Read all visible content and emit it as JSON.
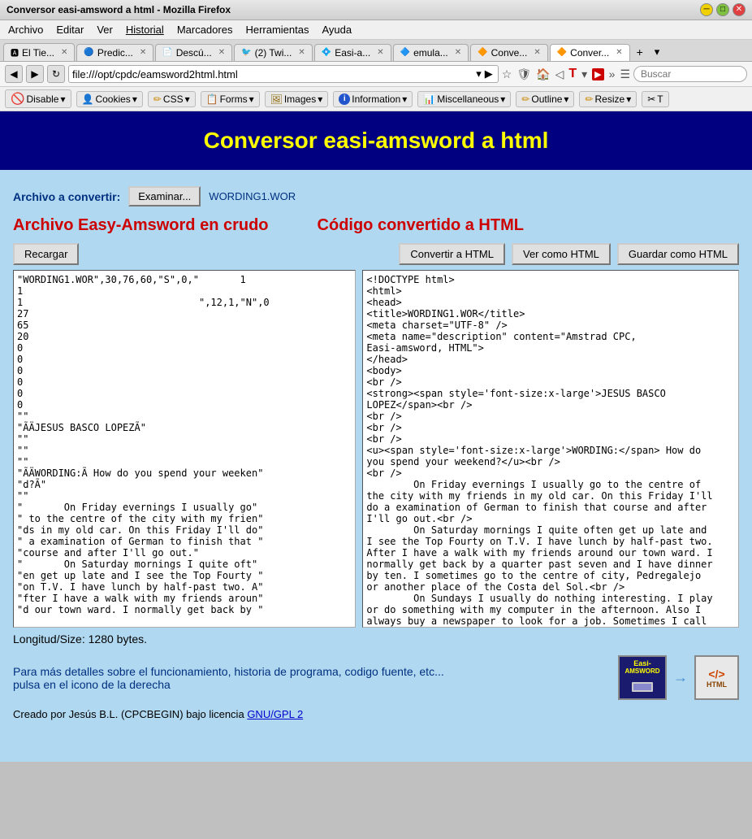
{
  "window": {
    "title": "Conversor easi-amsword a html - Mozilla Firefox"
  },
  "menu": {
    "items": [
      "Archivo",
      "Editar",
      "Ver",
      "Historial",
      "Marcadores",
      "Herramientas",
      "Ayuda"
    ]
  },
  "tabs": [
    {
      "label": "El Tie...",
      "icon": "🅰",
      "active": false
    },
    {
      "label": "Predic...",
      "icon": "🔵",
      "active": false
    },
    {
      "label": "Descú...",
      "icon": "📄",
      "active": false
    },
    {
      "label": "(2) Twi...",
      "icon": "🐦",
      "active": false
    },
    {
      "label": "Easi-a...",
      "icon": "💠",
      "active": false
    },
    {
      "label": "emula...",
      "icon": "🔷",
      "active": false
    },
    {
      "label": "Conve...",
      "icon": "🔶",
      "active": false
    },
    {
      "label": "Conver...",
      "icon": "🔶",
      "active": true
    }
  ],
  "address": {
    "url": "file:///opt/cpdc/eamsword2html.html",
    "search_placeholder": "Buscar"
  },
  "toolbar": {
    "disable_label": "Disable",
    "cookies_label": "Cookies",
    "css_label": "CSS",
    "forms_label": "Forms",
    "images_label": "Images",
    "information_label": "Information",
    "miscellaneous_label": "Miscellaneous",
    "outline_label": "Outline",
    "resize_label": "Resize"
  },
  "page": {
    "title": "Conversor easi-amsword a html",
    "file_label": "Archivo a convertir:",
    "browse_label": "Examinar...",
    "file_name": "WORDING1.WOR",
    "raw_title": "Archivo Easy-Amsword en crudo",
    "html_title": "Código convertido a HTML",
    "reload_btn": "Recargar",
    "convert_btn": "Convertir a HTML",
    "view_btn": "Ver como HTML",
    "save_btn": "Guardar como HTML",
    "raw_content": "\"WORDING1.WOR\",30,76,60,\"S\",0,\"       1\n1\n1                              \",12,1,\"N\",0\n27\n65\n20\n0\n0\n0\n0\n0\n0\n\"\"\n\"ÃÄJESUS BASCO LOPEZÃ\"\n\"\"\n\"\"\n\"\"\n\"ÃÄWORDING:Ã How do you spend your weeken\"\n\"d?Ã\"\n\"\"\n\"       On Friday evernings I usually go\"\n\" to the centre of the city with my frien\"\n\"ds in my old car. On this Friday I'll do\"\n\" a examination of German to finish that \"\n\"course and after I'll go out.\"\n\"       On Saturday mornings I quite oft\"\n\"en get up late and I see the Top Fourty \"\n\"on T.V. I have lunch by half-past two. A\"\n\"fter I have a walk with my friends aroun\"\n\"d our town ward. I normally get back by \"",
    "html_content": "<!DOCTYPE html>\n<html>\n<head>\n<title>WORDING1.WOR</title>\n<meta charset=\"UTF-8\" />\n<meta name=\"description\" content=\"Amstrad CPC,\nEasi-amsword, HTML\">\n</head>\n<body>\n<br />\n<strong><span style='font-size:x-large'>JESUS BASCO\nLOPEZ</span><br />\n<br />\n<br />\n<br />\n<u><span style='font-size:x-large'>WORDING:</span> How do\nyou spend your weekend?</u><br />\n<br />\n        On Friday evernings I usually go to the centre of\nthe city with my friends in my old car. On this Friday I'll\ndo a examination of German to finish that course and after\nI'll go out.<br />\n        On Saturday mornings I quite often get up late and\nI see the Top Fourty on T.V. I have lunch by half-past two.\nAfter I have a walk with my friends around our town ward. I\nnormally get back by a quarter past seven and I have dinner\nby ten. I sometimes go to the centre of city, Pedregalejo\nor another place of the Costa del Sol.<br />\n        On Sundays I usually do nothing interesting. I play\nor do something with my computer in the afternoon. Also I\nalways buy a newspaper to look for a job. Sometimes I call",
    "size_info": "Longitud/Size: 1280 bytes.",
    "footer_text": "Para más detalles sobre el funcionamiento, historia de programa, codigo fuente, etc...\npulsa en el icono de la derecha",
    "credits": "Creado por Jesús B.L. (CPCBEGIN) bajo licencia",
    "license_link": "GNU/GPL 2"
  }
}
